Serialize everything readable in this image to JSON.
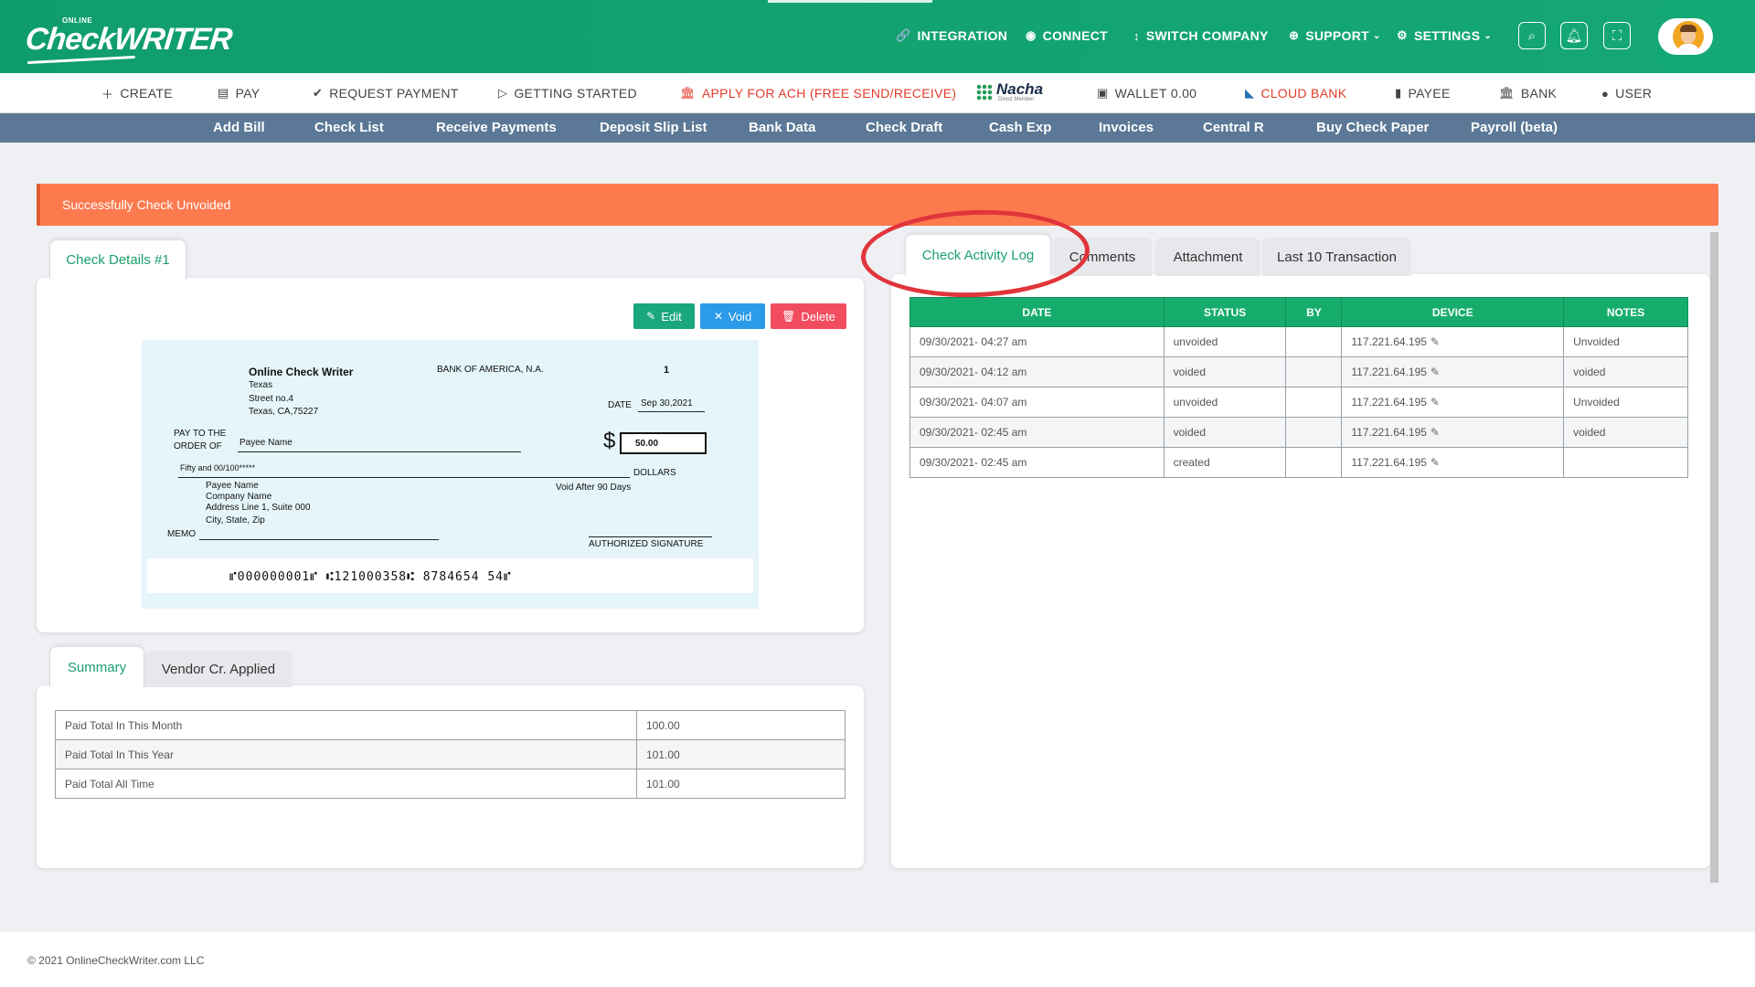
{
  "brand": {
    "logo_small": "ONLINE",
    "logo_big": "CheckWRITER"
  },
  "topnav": {
    "integration": "INTEGRATION",
    "connect": "CONNECT",
    "switch_company": "SWITCH COMPANY",
    "support": "SUPPORT",
    "settings": "SETTINGS"
  },
  "secondnav": {
    "create": "CREATE",
    "pay": "PAY",
    "request_payment": "REQUEST PAYMENT",
    "getting_started": "GETTING STARTED",
    "apply_ach": "APPLY FOR ACH (FREE SEND/RECEIVE)",
    "nacha": "Nacha",
    "nacha_sub": "Direct Member",
    "wallet": "WALLET 0.00",
    "cloud_bank": "CLOUD BANK",
    "payee": "PAYEE",
    "bank": "BANK",
    "user": "USER"
  },
  "thirdnav": {
    "add_bill": "Add Bill",
    "check_list": "Check List",
    "receive_payments": "Receive Payments",
    "deposit_slip_list": "Deposit Slip List",
    "bank_data": "Bank Data",
    "check_draft": "Check Draft",
    "cash_exp": "Cash Exp",
    "invoices": "Invoices",
    "central_r": "Central R",
    "buy_check_paper": "Buy Check Paper",
    "payroll": "Payroll (beta)"
  },
  "alert": {
    "message": "Successfully Check Unvoided"
  },
  "check_details": {
    "tab": "Check Details #1",
    "edit": "Edit",
    "void": "Void",
    "delete": "Delete",
    "check": {
      "company_name": "Online Check Writer",
      "company_state": "Texas",
      "company_street": "Street no.4",
      "company_city": "Texas, CA,75227",
      "bank_name": "BANK OF AMERICA, N.A.",
      "check_number": "1",
      "date_label": "DATE",
      "date_value": "Sep 30,2021",
      "pay_to_label_1": "PAY TO THE",
      "pay_to_label_2": "ORDER OF",
      "payee_name": "Payee Name",
      "dollar_sign": "$",
      "amount": "50.00",
      "amount_words": "Fifty  and 00/100*****",
      "dollars_label": "DOLLARS",
      "address_1": "Payee Name",
      "address_2": "Company Name",
      "address_3": "Address Line 1, Suite 000",
      "address_4": "City, State, Zip",
      "void_after": "Void After 90 Days",
      "memo_label": "MEMO",
      "signature_label": "AUTHORIZED SIGNATURE",
      "micr": "⑈000000001⑈ ⑆121000358⑆ 8784654 54⑈"
    }
  },
  "summary": {
    "tab_summary": "Summary",
    "tab_vendor": "Vendor Cr. Applied",
    "rows": [
      {
        "label": "Paid Total In This Month",
        "value": "100.00"
      },
      {
        "label": "Paid Total In This Year",
        "value": "101.00"
      },
      {
        "label": "Paid Total All Time",
        "value": "101.00"
      }
    ]
  },
  "activity": {
    "tabs": [
      "Check Activity Log",
      "Comments",
      "Attachment",
      "Last 10 Transaction"
    ],
    "headers": [
      "DATE",
      "STATUS",
      "BY",
      "DEVICE",
      "NOTES"
    ],
    "rows": [
      {
        "date": "09/30/2021- 04:27 am",
        "status": "unvoided",
        "by": "",
        "device": "117.221.64.195",
        "notes": "Unvoided"
      },
      {
        "date": "09/30/2021- 04:12 am",
        "status": "voided",
        "by": "",
        "device": "117.221.64.195",
        "notes": "voided"
      },
      {
        "date": "09/30/2021- 04:07 am",
        "status": "unvoided",
        "by": "",
        "device": "117.221.64.195",
        "notes": "Unvoided"
      },
      {
        "date": "09/30/2021- 02:45 am",
        "status": "voided",
        "by": "",
        "device": "117.221.64.195",
        "notes": "voided"
      },
      {
        "date": "09/30/2021- 02:45 am",
        "status": "created",
        "by": "",
        "device": "117.221.64.195",
        "notes": ""
      }
    ]
  },
  "footer": {
    "copyright": "© 2021 OnlineCheckWriter.com LLC"
  },
  "colors": {
    "brand_green": "#14a874",
    "alert_orange": "#fd7a4f",
    "nav_blue": "#5b7896",
    "highlight_red": "#e0353b"
  }
}
